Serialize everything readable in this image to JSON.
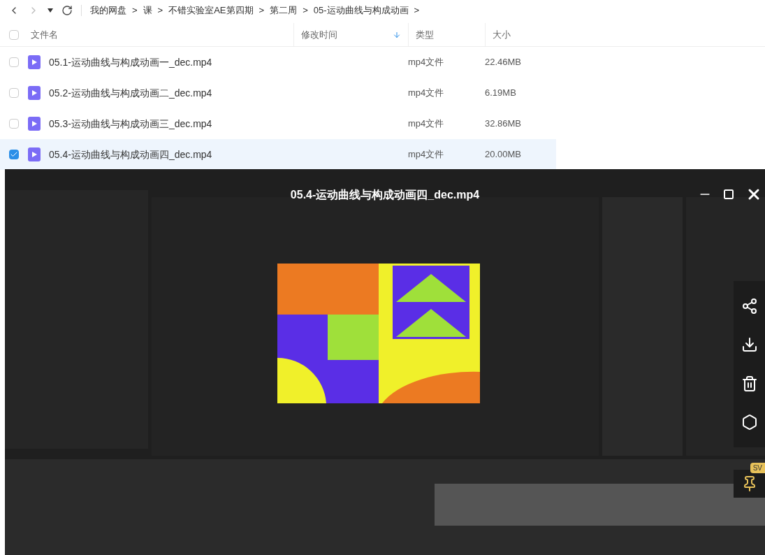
{
  "nav": {
    "breadcrumbs": [
      "我的网盘",
      "课",
      "不错实验室AE第四期",
      "第二周",
      "05-运动曲线与构成动画"
    ],
    "separator": ">"
  },
  "table": {
    "select_all": {
      "checked": false
    },
    "columns": [
      {
        "label": "文件名",
        "sorted": false
      },
      {
        "label": "修改时间",
        "sorted": true
      },
      {
        "label": "类型",
        "sorted": false
      },
      {
        "label": "大小",
        "sorted": false
      }
    ],
    "rows": [
      {
        "name": "05.1-运动曲线与构成动画一_dec.mp4",
        "type": "mp4文件",
        "size": "22.46MB",
        "selected": false
      },
      {
        "name": "05.2-运动曲线与构成动画二_dec.mp4",
        "type": "mp4文件",
        "size": "6.19MB",
        "selected": false
      },
      {
        "name": "05.3-运动曲线与构成动画三_dec.mp4",
        "type": "mp4文件",
        "size": "32.86MB",
        "selected": false
      },
      {
        "name": "05.4-运动曲线与构成动画四_dec.mp4",
        "type": "mp4文件",
        "size": "20.00MB",
        "selected": true
      }
    ]
  },
  "player": {
    "title": "05.4-运动曲线与构成动画四_dec.mp4",
    "pin_badge": "SV"
  }
}
